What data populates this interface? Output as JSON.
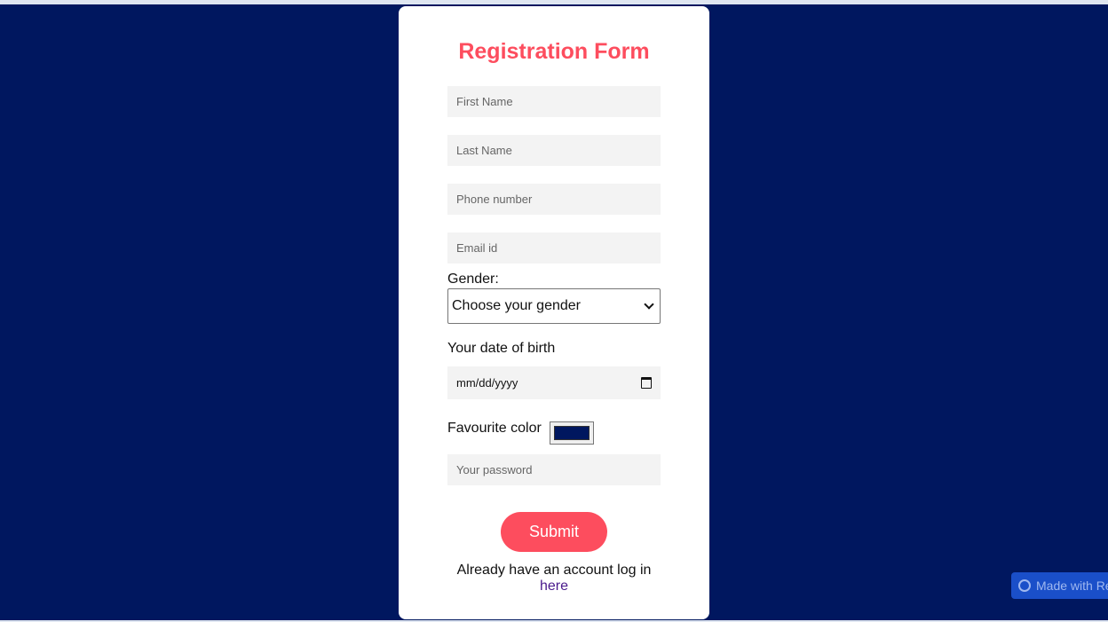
{
  "form": {
    "title": "Registration Form",
    "first_name_placeholder": "First Name",
    "last_name_placeholder": "Last Name",
    "phone_placeholder": "Phone number",
    "email_placeholder": "Email id",
    "gender_label": "Gender:",
    "gender_selected": "Choose your gender",
    "dob_label": "Your date of birth",
    "dob_placeholder": "mm/dd/yyyy",
    "color_label": "Favourite color",
    "color_value": "#00175f",
    "password_placeholder": "Your password",
    "submit_label": "Submit",
    "login_text": "Already have an account log in",
    "login_link": "here"
  },
  "badge": {
    "label": "Made with Re"
  },
  "colors": {
    "background": "#00175f",
    "accent": "#fd4d5e",
    "field_bg": "#f3f3f3",
    "link": "#4a1a8c"
  }
}
